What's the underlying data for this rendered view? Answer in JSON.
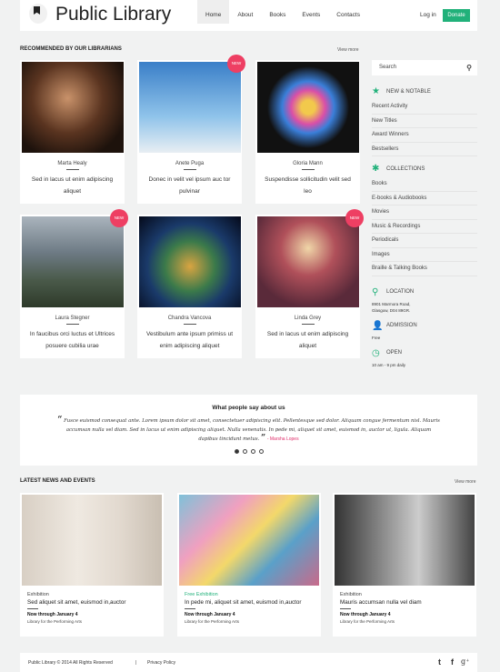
{
  "header": {
    "logo": "Public Library",
    "nav": [
      "Home",
      "About",
      "Books",
      "Events",
      "Contacts"
    ],
    "active": "Home",
    "login": "Log in",
    "donate": "Donate"
  },
  "recommended": {
    "title": "RECOMMENDED BY OUR LIBRARIANS",
    "view_more": "View more",
    "new_badge": "NEW",
    "items": [
      {
        "name": "Marta Healy",
        "desc": "Sed in lacus ut enim adipiscing aliquet",
        "is_new": false
      },
      {
        "name": "Anete Puga",
        "desc": "Donec in velit vel ipsum auc tor pulvinar",
        "is_new": true
      },
      {
        "name": "Gloria Mann",
        "desc": "Suspendisse sollicitudin velit sed leo",
        "is_new": false
      },
      {
        "name": "Laura Stegner",
        "desc": "In faucibus orci luctus et Ultrices posuere cubilia urae",
        "is_new": true
      },
      {
        "name": "Chandra Vancova",
        "desc": "Vestibulum ante ipsum primiss ut enim adipiscing aliquet",
        "is_new": false
      },
      {
        "name": "Linda Grey",
        "desc": "Sed in lacus ut enim adipiscing aliquet",
        "is_new": true
      }
    ]
  },
  "sidebar": {
    "search_placeholder": "Search",
    "new_notable": {
      "title": "NEW & NOTABLE",
      "items": [
        "Recent Activity",
        "New Titles",
        "Award Winners",
        "Bestsellers"
      ]
    },
    "collections": {
      "title": "COLLECTIONS",
      "items": [
        "Books",
        "E-books & Audiobooks",
        "Movies",
        "Music & Recordings",
        "Periodicals",
        "Images",
        "Braille & Talking Books"
      ]
    },
    "location": {
      "title": "LOCATION",
      "line1": "8901 Marmora Road,",
      "line2": "Glasgow, D04 89GR."
    },
    "admission": {
      "title": "ADMISSION",
      "text": "Free"
    },
    "open": {
      "title": "OPEN",
      "text": "10 am - 9 pm daily"
    }
  },
  "testimonial": {
    "title": "What people say about us",
    "quote": "Fusce euismod consequat ante. Lorem ipsum dolor sit amet, consectetuer adipiscing elit. Pellentesque sed dolor. Aliquam congue fermentum nisl. Mauris accumsan nulla vel diam. Sed in lacus ut enim adipiscing aliquet. Nulla venenatis. In pede mi, aliquet sit amet, euismod in, auctor ut, ligula. Aliquam dapibus tincidunt metus.",
    "author": "- Marsha Lopes",
    "slides": 4,
    "active_slide": 1
  },
  "news": {
    "title": "LATEST NEWS AND EVENTS",
    "view_more": "View more",
    "items": [
      {
        "category": "Exhibition",
        "title": "Sed aliquet sit amet, euismod in,auctor",
        "date": "Now through January 4",
        "location": "Library for the Performing Arts",
        "free": false
      },
      {
        "category": "Free Exhibition",
        "title": "In pede mi, aliquet sit amet, euismod in,auctor",
        "date": "Now through January 4",
        "location": "Library for the Performing Arts",
        "free": true
      },
      {
        "category": "Exhibition",
        "title": "Mauris accumsan nulla vel diam",
        "date": "Now through January 4",
        "location": "Library for the Performing Arts",
        "free": false
      }
    ]
  },
  "footer": {
    "copyright": "Public Library © 2014 All Rights Reserved",
    "separator": "|",
    "privacy": "Privacy Policy",
    "social": [
      "twitter-icon",
      "facebook-icon",
      "google-plus-icon"
    ]
  },
  "colors": {
    "accent": "#21b17a",
    "badge": "#ee3f63",
    "author": "#e0306c"
  }
}
